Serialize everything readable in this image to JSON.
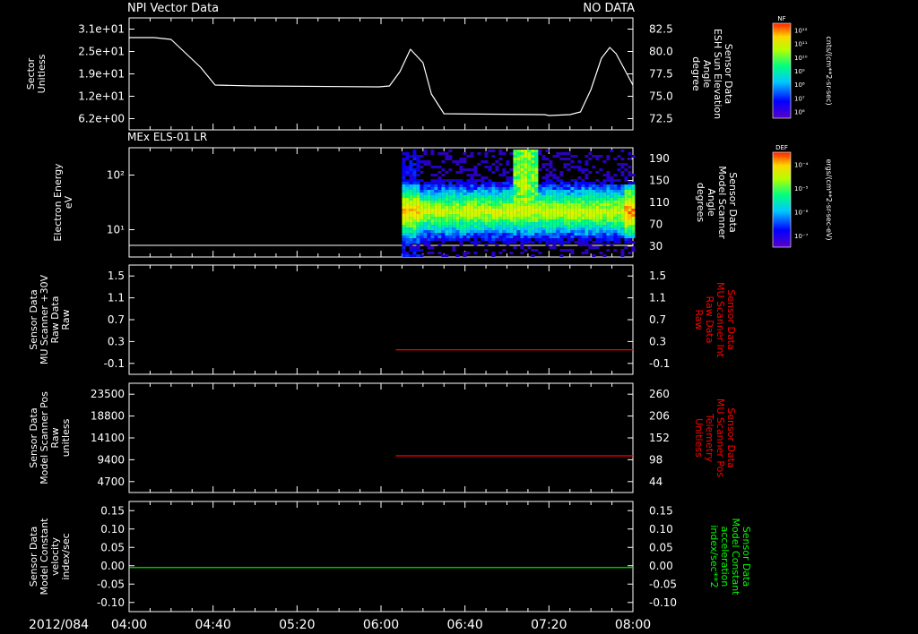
{
  "header": {
    "left_title": "NPI Vector Data",
    "right_note": "NO DATA"
  },
  "date_label": "2012/084",
  "time_ticks": [
    "04:00",
    "04:40",
    "05:20",
    "06:00",
    "06:40",
    "07:20",
    "08:00"
  ],
  "colors": {
    "white": "#ffffff",
    "red": "#ff0000",
    "green": "#00ff00"
  },
  "colorbars": [
    {
      "name": "NF",
      "label": "cnts/(cm**2-sr-sec)",
      "ticks": [
        "10¹²",
        "10¹¹",
        "10¹⁰",
        "10⁹",
        "10⁸",
        "10⁷",
        "10⁶"
      ]
    },
    {
      "name": "DEF",
      "label": "ergs/(cm**2-sr-sec-eV)",
      "ticks": [
        "10⁻⁴",
        "10⁻⁵",
        "10⁻⁶",
        "10⁻⁷"
      ]
    }
  ],
  "chart_data": [
    {
      "type": "line",
      "left_label": [
        "Sector",
        "Unitless"
      ],
      "left_ticks": [
        "3.1e+01",
        "2.5e+01",
        "1.9e+01",
        "1.2e+01",
        "6.2e+00"
      ],
      "right_label": [
        "Sensor Data",
        "ESH Sun Elevation",
        "Angle",
        "degree"
      ],
      "right_ticks": [
        "82.5",
        "80.0",
        "77.5",
        "75.0",
        "72.5"
      ],
      "ylim": [
        70.0,
        82.5
      ],
      "series": [
        {
          "color": "white",
          "x_minutes": [
            0,
            12,
            20,
            34,
            41,
            59,
            60,
            119,
            124,
            129,
            134,
            140,
            144,
            150,
            198,
            200,
            210,
            215,
            220,
            225,
            229,
            232,
            240
          ],
          "y": [
            80.3,
            80.3,
            80.1,
            77.0,
            75.0,
            74.9,
            74.9,
            74.8,
            74.9,
            76.5,
            79.0,
            77.5,
            74.0,
            71.8,
            71.7,
            71.6,
            71.7,
            72.0,
            74.5,
            78.0,
            79.2,
            78.5,
            75.0
          ]
        }
      ]
    },
    {
      "type": "heatmap",
      "title": "MEx ELS-01 LR",
      "left_label": [
        "Electron Energy",
        "eV"
      ],
      "left_ticks": [
        "10²",
        "10¹"
      ],
      "right_label": [
        "Sensor Data",
        "Model Scanner",
        "Angle",
        "degrees"
      ],
      "right_ticks": [
        "190",
        "150",
        "110",
        "70",
        "30"
      ],
      "data_start_time": "06:10",
      "band_energy_eV": 15,
      "spike_time": "07:08"
    },
    {
      "type": "line",
      "left_label": [
        "Sensor Data",
        "MU Scanner +30V",
        "Raw Data",
        "Raw"
      ],
      "left_ticks": [
        "1.5",
        "1.1",
        "0.7",
        "0.3",
        "-0.1"
      ],
      "right_label": [
        "Sensor Data",
        "MU Scanner Int",
        "Raw Data",
        "Raw"
      ],
      "right_ticks": [
        "1.5",
        "1.1",
        "0.7",
        "0.3",
        "-0.1"
      ],
      "ylim": [
        -0.5,
        1.5
      ],
      "series": [
        {
          "color": "red",
          "x_minutes": [
            127,
            240
          ],
          "y": [
            -0.05,
            -0.05
          ]
        }
      ]
    },
    {
      "type": "line",
      "left_label": [
        "Sensor Data",
        "Model Scanner Pos",
        "Raw",
        "unitless"
      ],
      "left_ticks": [
        "23500",
        "18800",
        "14100",
        "9400",
        "4700"
      ],
      "right_label": [
        "Sensor Data",
        "MU Scanner Pos",
        "Telemetry",
        "Unitless"
      ],
      "right_ticks": [
        "260",
        "206",
        "152",
        "98",
        "44"
      ],
      "ylim": [
        0,
        23500
      ],
      "series": [
        {
          "color": "red",
          "x_minutes": [
            127,
            240
          ],
          "y": [
            7900,
            7900
          ]
        }
      ]
    },
    {
      "type": "line",
      "left_label": [
        "Sensor Data",
        "Model Constant",
        "velocity",
        "index/sec"
      ],
      "left_ticks": [
        "0.15",
        "0.10",
        "0.05",
        "0.00",
        "-0.05",
        "-0.10"
      ],
      "right_label": [
        "Sensor Data",
        "Model Constant",
        "acceleration",
        "index/sec**2"
      ],
      "right_ticks": [
        "0.15",
        "0.10",
        "0.05",
        "0.00",
        "-0.05",
        "-0.10"
      ],
      "ylim": [
        -0.1,
        0.15
      ],
      "series": [
        {
          "color": "green",
          "x_minutes": [
            0,
            240
          ],
          "y": [
            0.0,
            0.0
          ]
        }
      ]
    }
  ]
}
